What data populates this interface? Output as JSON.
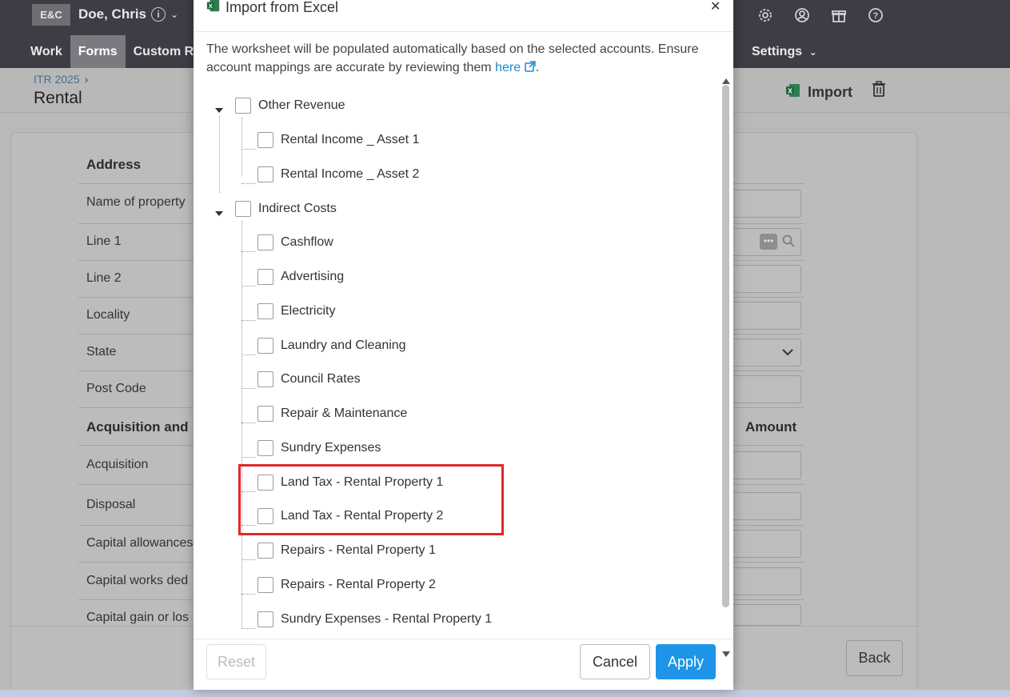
{
  "header": {
    "logo": "E&C",
    "client_name": "Doe, Chris",
    "info_glyph": "i",
    "icons": [
      "gear-icon",
      "user-circle-icon",
      "gift-icon",
      "help-icon"
    ]
  },
  "nav": {
    "tabs": [
      "Work",
      "Forms",
      "Custom Re"
    ],
    "active_tab": "Forms",
    "settings_label": "Settings"
  },
  "page": {
    "breadcrumb": "ITR 2025",
    "breadcrumb_sep": "›",
    "title": "Rental",
    "import_label": "Import"
  },
  "form": {
    "address_heading": "Address",
    "fields": [
      "Name of property",
      "Line 1",
      "Line 2",
      "Locality",
      "State",
      "Post Code"
    ],
    "acquisition_heading": "Acquisition and",
    "amount_heading": "Amount",
    "acq_fields": [
      "Acquisition",
      "Disposal",
      "Capital allowances",
      "Capital works ded",
      "Capital gain or los"
    ],
    "dots": "•••",
    "back_label": "Back"
  },
  "modal": {
    "title": "Import from Excel",
    "close_glyph": "✕",
    "intro_text": "The worksheet will be populated automatically based on the selected accounts. Ensure account mappings are accurate by reviewing them ",
    "intro_link": "here",
    "intro_end": ".",
    "tree": {
      "group1": "Other Revenue",
      "group1_items": [
        "Rental Income _ Asset 1",
        "Rental Income _ Asset 2"
      ],
      "group2": "Indirect Costs",
      "group2_items": [
        "Cashflow",
        "Advertising",
        "Electricity",
        "Laundry and Cleaning",
        "Council Rates",
        "Repair & Maintenance",
        "Sundry Expenses",
        "Land Tax - Rental Property 1",
        "Land Tax - Rental Property 2",
        "Repairs - Rental Property 1",
        "Repairs - Rental Property 2",
        "Sundry Expenses - Rental Property 1"
      ]
    },
    "buttons": {
      "reset": "Reset",
      "cancel": "Cancel",
      "apply": "Apply"
    }
  },
  "colors": {
    "accent": "#1e95e8",
    "highlight": "#e0282c",
    "topbar": "#3e3c45"
  }
}
